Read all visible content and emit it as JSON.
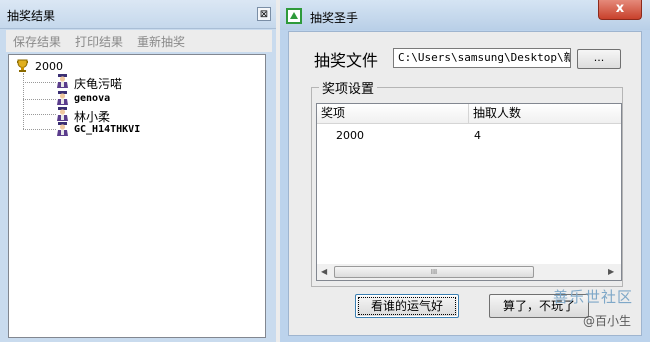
{
  "left_window": {
    "title": "抽奖结果",
    "close_glyph": "⊠",
    "menu": [
      "保存结果",
      "打印结果",
      "重新抽奖"
    ],
    "tree": {
      "root": "2000",
      "children": [
        "庆龟污喏",
        "genova",
        "林小柔",
        "GC_H14THKVI"
      ]
    }
  },
  "right_window": {
    "title": "抽奖圣手",
    "close_glyph": "x",
    "file_label": "抽奖文件",
    "file_path": "C:\\Users\\samsung\\Desktop\\新建",
    "browse_label": "...",
    "group_label": "奖项设置",
    "columns": [
      "奖项",
      "抽取人数"
    ],
    "rows": [
      [
        "2000",
        "4"
      ]
    ],
    "scroll_thumb_glyph": "III",
    "buttons": {
      "draw": "看谁的运气好",
      "quit": "算了，不玩了"
    }
  },
  "watermark": {
    "line1": "善乐世社区",
    "line2": "@百小生"
  }
}
